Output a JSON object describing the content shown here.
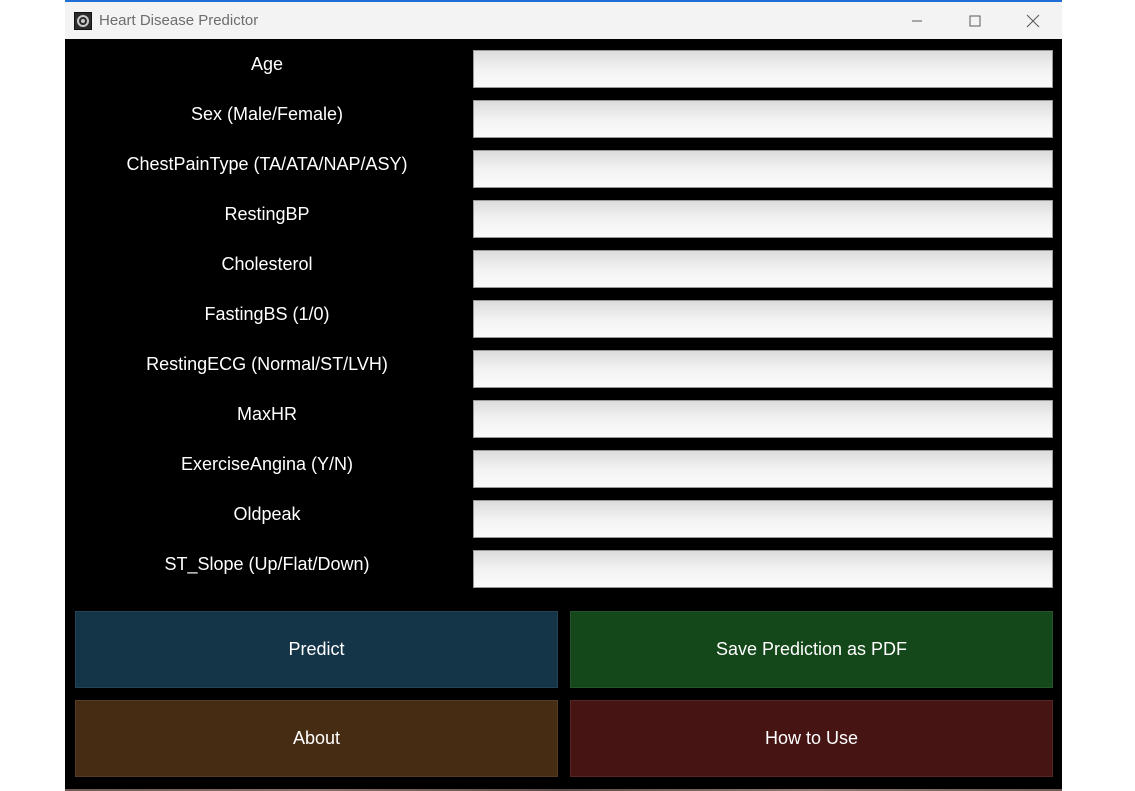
{
  "window": {
    "title": "Heart Disease Predictor",
    "app_icon": "target-icon",
    "controls": {
      "minimize_icon": "minimize-icon",
      "maximize_icon": "maximize-icon",
      "close_icon": "close-icon"
    }
  },
  "form": {
    "fields": [
      {
        "label": "Age",
        "value": ""
      },
      {
        "label": "Sex (Male/Female)",
        "value": ""
      },
      {
        "label": "ChestPainType (TA/ATA/NAP/ASY)",
        "value": ""
      },
      {
        "label": "RestingBP",
        "value": ""
      },
      {
        "label": "Cholesterol",
        "value": ""
      },
      {
        "label": "FastingBS (1/0)",
        "value": ""
      },
      {
        "label": "RestingECG (Normal/ST/LVH)",
        "value": ""
      },
      {
        "label": "MaxHR",
        "value": ""
      },
      {
        "label": "ExerciseAngina (Y/N)",
        "value": ""
      },
      {
        "label": "Oldpeak",
        "value": ""
      },
      {
        "label": "ST_Slope (Up/Flat/Down)",
        "value": ""
      }
    ]
  },
  "actions": {
    "predict": {
      "label": "Predict",
      "color": "#143447"
    },
    "save_pdf": {
      "label": "Save Prediction as PDF",
      "color": "#14471a"
    },
    "about": {
      "label": "About",
      "color": "#472c14"
    },
    "how_to_use": {
      "label": "How to Use",
      "color": "#471414"
    }
  },
  "colors": {
    "background": "#000000",
    "label_text": "#ffffff",
    "titlebar": "#f3f3f3"
  }
}
